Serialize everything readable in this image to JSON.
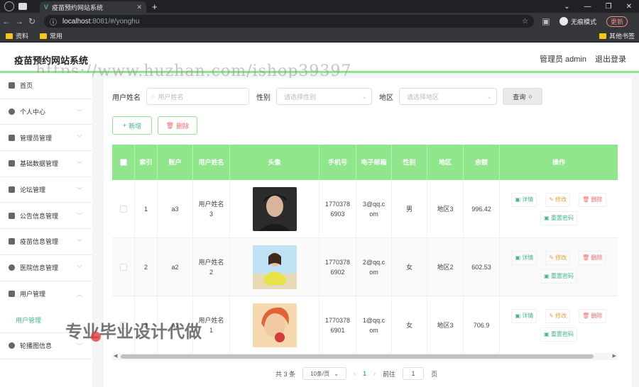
{
  "browser": {
    "tab_title": "疫苗预约网站系统",
    "url_host": "localhost",
    "url_rest": ":8081/#/yonghu",
    "incognito_label": "无痕模式",
    "update_label": "更新",
    "bookmarks": [
      "资料",
      "常用"
    ],
    "other_bookmarks": "其他书签"
  },
  "header": {
    "title": "疫苗预约网站系统",
    "admin_label": "管理员 admin",
    "logout_label": "退出登录"
  },
  "watermarks": {
    "top": "https://www.huzhan.com/ishop39397",
    "bottom": "专业毕业设计代做"
  },
  "sidebar": {
    "items": [
      {
        "label": "首页",
        "icon": "home-icon"
      },
      {
        "label": "个人中心",
        "icon": "user-icon"
      },
      {
        "label": "管理员管理",
        "icon": "mic-icon"
      },
      {
        "label": "基础数据管理",
        "icon": "person-icon"
      },
      {
        "label": "论坛管理",
        "icon": "forum-icon"
      },
      {
        "label": "公告信息管理",
        "icon": "notice-icon"
      },
      {
        "label": "疫苗信息管理",
        "icon": "vaccine-icon"
      },
      {
        "label": "医院信息管理",
        "icon": "hospital-icon"
      },
      {
        "label": "用户管理",
        "icon": "users-icon"
      },
      {
        "label": "用户管理",
        "icon": ""
      },
      {
        "label": "轮播图信息",
        "icon": "carousel-icon"
      }
    ]
  },
  "search": {
    "username_label": "用户姓名",
    "username_placeholder": "用户姓名",
    "gender_label": "性别",
    "gender_placeholder": "请选择性别",
    "area_label": "地区",
    "area_placeholder": "请选择地区",
    "query_label": "查询"
  },
  "actions": {
    "add_label": "新增",
    "delete_label": "删除"
  },
  "table": {
    "headers": [
      "索引",
      "账户",
      "用户姓名",
      "头像",
      "手机号",
      "电子邮箱",
      "性别",
      "地区",
      "余额",
      "操作"
    ],
    "rows": [
      {
        "index": "1",
        "account": "a3",
        "name": "用户姓名\n3",
        "phone": "1770378\n6903",
        "email": "3@qq.c\nom",
        "gender": "男",
        "area": "地区3",
        "balance": "996.42"
      },
      {
        "index": "2",
        "account": "a2",
        "name": "用户姓名\n2",
        "phone": "1770378\n6902",
        "email": "2@qq.c\nom",
        "gender": "女",
        "area": "地区2",
        "balance": "602.53"
      },
      {
        "index": "3",
        "account": "a1",
        "name": "用户姓名\n1",
        "phone": "1770378\n6901",
        "email": "1@qq.c\nom",
        "gender": "女",
        "area": "地区3",
        "balance": "706.9"
      }
    ],
    "ops": {
      "view": "详情",
      "edit": "修改",
      "del": "删除",
      "reset": "重置密码"
    }
  },
  "pager": {
    "total": "共 3 条",
    "size": "10条/页",
    "current": "1",
    "goto_label": "前往",
    "goto_value": "1",
    "page_suffix": "页"
  }
}
